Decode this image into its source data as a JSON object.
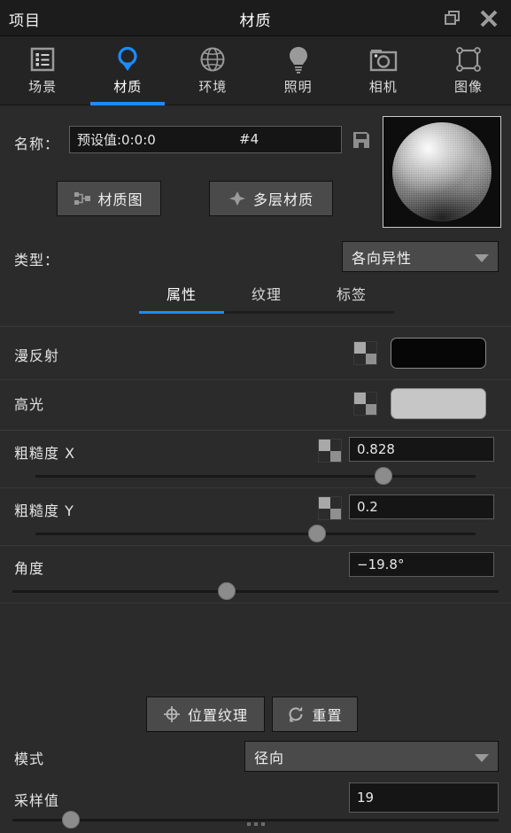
{
  "window": {
    "project_label": "项目",
    "title": "材质",
    "restore_icon": "restore-window-icon",
    "close_icon": "close-icon"
  },
  "tabs": [
    {
      "label": "场景",
      "icon": "list-scene-icon",
      "active": false
    },
    {
      "label": "材质",
      "icon": "material-sphere-icon",
      "active": true
    },
    {
      "label": "环境",
      "icon": "globe-icon",
      "active": false
    },
    {
      "label": "照明",
      "icon": "lightbulb-icon",
      "active": false
    },
    {
      "label": "相机",
      "icon": "camera-icon",
      "active": false
    },
    {
      "label": "图像",
      "icon": "image-frame-icon",
      "active": false
    }
  ],
  "name_row": {
    "label": "名称：",
    "value": "预设值:0:0:0",
    "suffix": "#4",
    "placeholder": "预设值:0:0:0",
    "save_icon": "floppy-save-icon"
  },
  "buttons": {
    "material_map": {
      "label": "材质图",
      "icon": "node-graph-icon"
    },
    "multilayer": {
      "label": "多层材质",
      "icon": "layers-diamond-icon"
    },
    "place_texture": {
      "label": "位置纹理",
      "icon": "crosshair-target-icon"
    },
    "reset": {
      "label": "重置",
      "icon": "refresh-circular-icon"
    }
  },
  "type_row": {
    "label": "类型：",
    "value": "各向异性",
    "caret_icon": "chevron-down-icon"
  },
  "subtabs": [
    {
      "label": "属性",
      "active": true
    },
    {
      "label": "纹理",
      "active": false
    },
    {
      "label": "标签",
      "active": false
    }
  ],
  "properties": {
    "diffuse": {
      "label": "漫反射",
      "checker_icon": "checker-texture-icon",
      "color": "#060606"
    },
    "specular": {
      "label": "高光",
      "checker_icon": "checker-texture-icon",
      "color": "#c6c6c6"
    },
    "roughness_x": {
      "label": "粗糙度 X",
      "checker_icon": "checker-texture-icon",
      "value": "0.828",
      "slider_percent": 79
    },
    "roughness_y": {
      "label": "粗糙度 Y",
      "checker_icon": "checker-texture-icon",
      "value": "0.2",
      "slider_percent": 64
    },
    "angle": {
      "label": "角度",
      "value": "−19.8°",
      "slider_percent": 44
    },
    "mode": {
      "label": "模式",
      "value": "径向",
      "caret_icon": "chevron-down-icon"
    },
    "samples": {
      "label": "采样值",
      "value": "19",
      "slider_percent": 12
    }
  },
  "accent_color": "#1a8cff",
  "footer": {
    "grip_icon": "drag-handle-dots-icon"
  }
}
